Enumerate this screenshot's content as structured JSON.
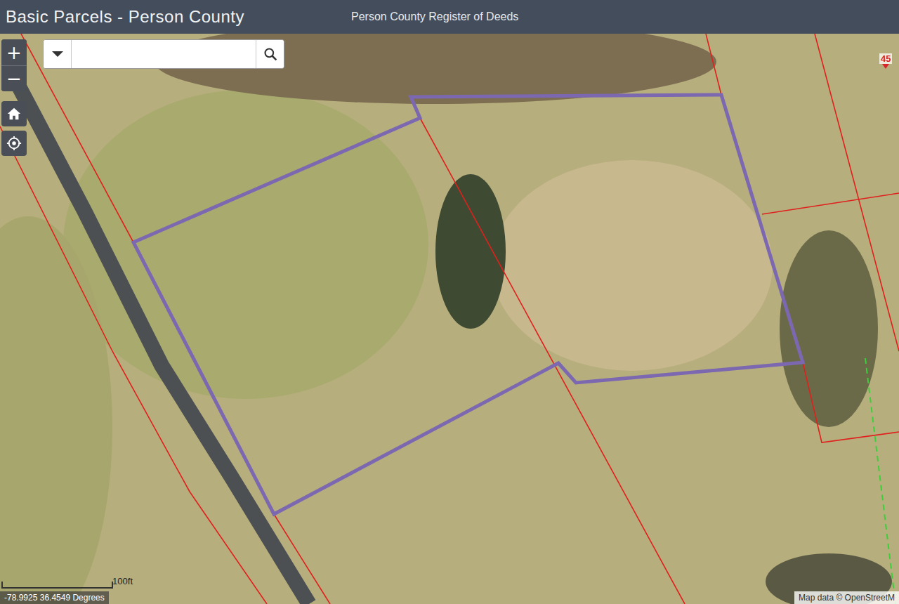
{
  "header": {
    "title": "Basic Parcels - Person County",
    "subtitle": "Person County Register of Deeds"
  },
  "zoom": {
    "in": "+",
    "out": "−"
  },
  "search": {
    "placeholder": "",
    "value": ""
  },
  "map": {
    "marker": {
      "label": "45"
    },
    "scale": {
      "label": "100ft"
    },
    "coordinates": "-78.9925 36.4549 Degrees",
    "attribution": "Map data © OpenStreetM"
  }
}
